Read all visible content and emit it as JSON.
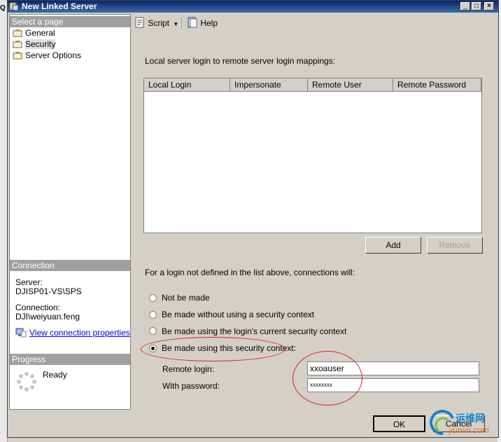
{
  "window": {
    "title": "New Linked Server"
  },
  "titlebar_buttons": [
    "_",
    "□",
    "×"
  ],
  "left_panel": {
    "select_page_header": "Select a page",
    "pages": [
      {
        "label": "General",
        "selected": false
      },
      {
        "label": "Security",
        "selected": true
      },
      {
        "label": "Server Options",
        "selected": false
      }
    ],
    "connection_header": "Connection",
    "server_label": "Server:",
    "server_value": "DJISP01-VS\\SPS",
    "connection_label": "Connection:",
    "connection_value": "DJI\\weiyuan.feng",
    "view_props_link": "View connection properties",
    "progress_header": "Progress",
    "progress_status": "Ready"
  },
  "toolbar": {
    "script_label": "Script",
    "help_label": "Help"
  },
  "mappings": {
    "caption": "Local server login to remote server login mappings:",
    "columns": [
      "Local Login",
      "Impersonate",
      "Remote User",
      "Remote Password"
    ],
    "rows": []
  },
  "buttons": {
    "add": "Add",
    "remove": "Remove",
    "ok": "OK",
    "cancel": "Cancel"
  },
  "not_defined_caption": "For a login not defined in the list above, connections will:",
  "options": [
    {
      "label": "Not be made",
      "checked": false
    },
    {
      "label": "Be made without using a security context",
      "checked": false
    },
    {
      "label": "Be made using the login's current security context",
      "checked": false
    },
    {
      "label": "Be made using this security context:",
      "checked": true
    }
  ],
  "remote_login": {
    "label": "Remote login:",
    "value": "xxoauser"
  },
  "with_password": {
    "label": "With password:",
    "value": "xxxxxxxx"
  },
  "watermark": {
    "cn": "运维网",
    "en": "yunvn.com"
  },
  "colors": {
    "title_bar": "#0a246a",
    "annotation": "#e02020",
    "link": "#0000ee"
  }
}
